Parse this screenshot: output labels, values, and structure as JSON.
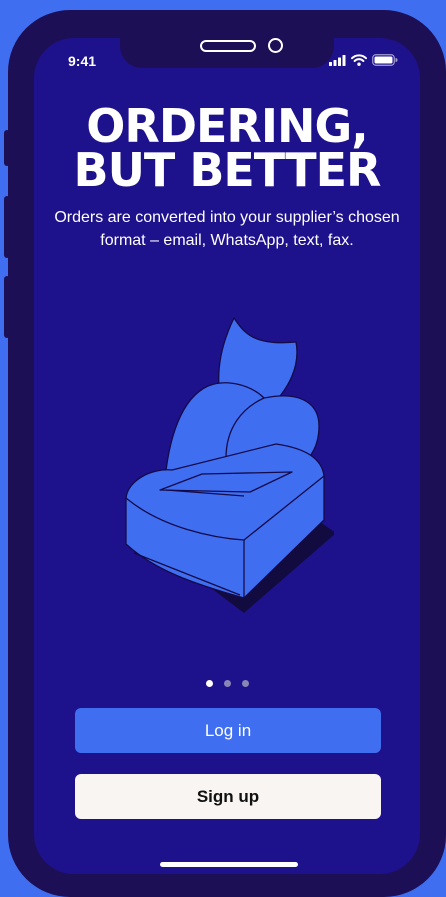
{
  "status_bar": {
    "time": "9:41"
  },
  "onboarding": {
    "headline_line1": "ORDERING,",
    "headline_line2": "BUT BETTER",
    "subtitle": "Orders are converted into your supplier’s chosen format – email, WhatsApp, text, fax.",
    "illustration_icon": "receipt-printer-icon",
    "pagination": {
      "total": 3,
      "active": 1
    }
  },
  "actions": {
    "login_label": "Log in",
    "signup_label": "Sign up"
  },
  "colors": {
    "background_outer": "#3f6ff0",
    "phone_frame": "#1d0f56",
    "screen_bg": "#1e118c",
    "accent": "#3f6ff0",
    "signup_bg": "#f8f5f2"
  }
}
